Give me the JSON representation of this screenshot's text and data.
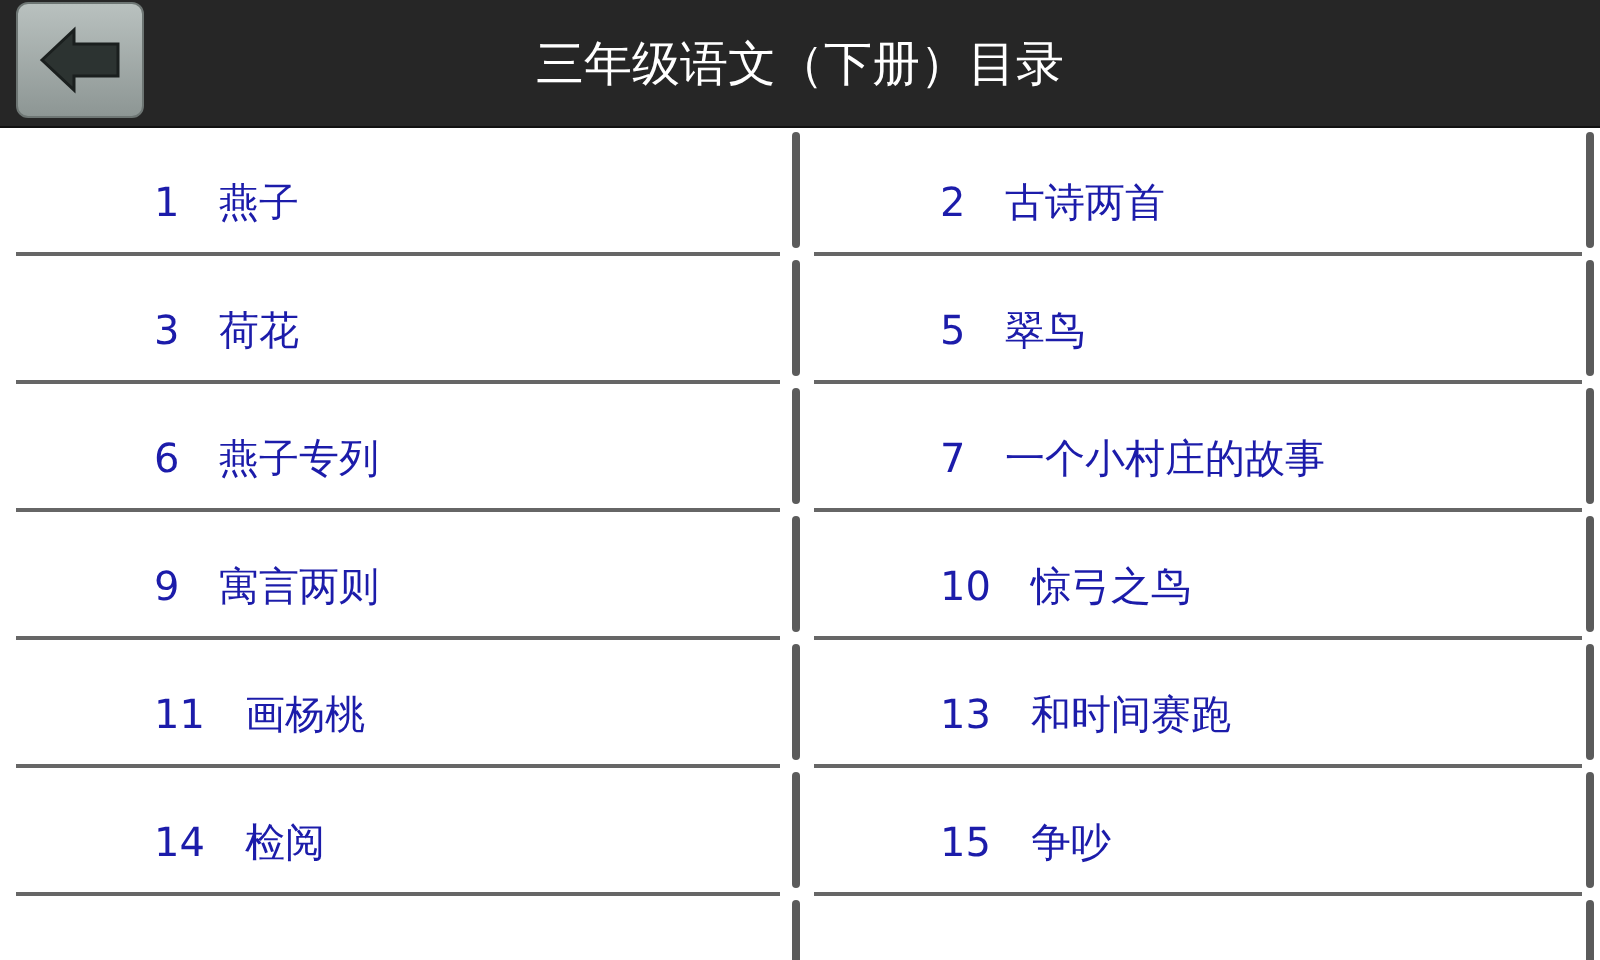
{
  "header": {
    "title": "三年级语文（下册）目录"
  },
  "lessons": [
    {
      "number": "1",
      "title": "燕子"
    },
    {
      "number": "2",
      "title": "古诗两首"
    },
    {
      "number": "3",
      "title": "荷花"
    },
    {
      "number": "5",
      "title": "翠鸟"
    },
    {
      "number": "6",
      "title": "燕子专列"
    },
    {
      "number": "7",
      "title": "一个小村庄的故事"
    },
    {
      "number": "9",
      "title": "寓言两则"
    },
    {
      "number": "10",
      "title": "惊弓之鸟"
    },
    {
      "number": "11",
      "title": "画杨桃"
    },
    {
      "number": "13",
      "title": "和时间赛跑"
    },
    {
      "number": "14",
      "title": "检阅"
    },
    {
      "number": "15",
      "title": "争吵"
    }
  ]
}
